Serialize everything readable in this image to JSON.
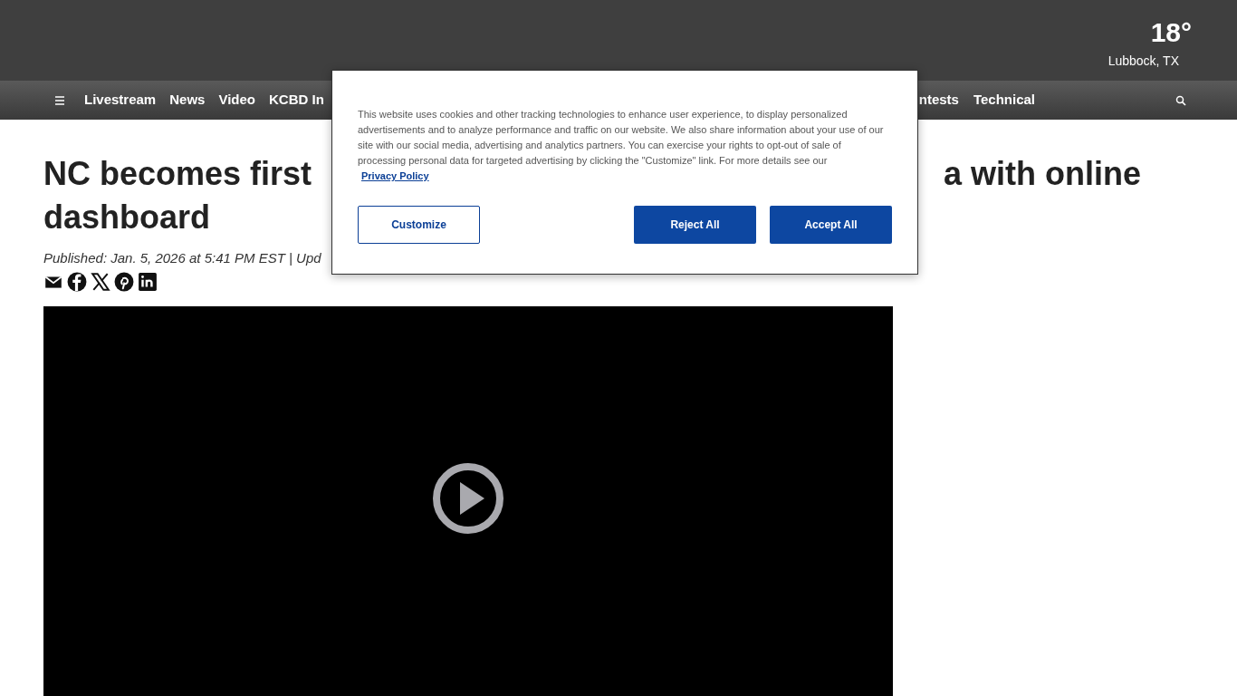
{
  "weather": {
    "temperature": "18°",
    "location": "Lubbock, TX"
  },
  "nav": {
    "items_left": [
      "Livestream",
      "News",
      "Video",
      "KCBD In"
    ],
    "items_right": [
      "ntests",
      "Technical"
    ]
  },
  "article": {
    "headline_parts": [
      "NC becomes first",
      "a with online",
      "dashboard"
    ],
    "byline": "Published: Jan. 5, 2026 at 5:41 PM EST | Upd",
    "share": [
      {
        "kind": "email"
      },
      {
        "kind": "facebook"
      },
      {
        "kind": "x"
      },
      {
        "kind": "pinterest"
      },
      {
        "kind": "linkedin"
      }
    ]
  },
  "cookie_dialog": {
    "text": "This website uses cookies and other tracking technologies to enhance user experience, to display personalized advertisements and to analyze performance and traffic on our website. We also share information about your use of our site with our social media, advertising and analytics partners. You can exercise your rights to opt-out of sale of processing personal data for targeted advertising by clicking the \"Customize\" link. For more details see our",
    "link": "Privacy Policy",
    "buttons": [
      {
        "label": "Customize",
        "kind": "outline"
      },
      {
        "label": "Reject All",
        "kind": "filled"
      },
      {
        "label": "Accept All",
        "kind": "filled"
      }
    ]
  }
}
